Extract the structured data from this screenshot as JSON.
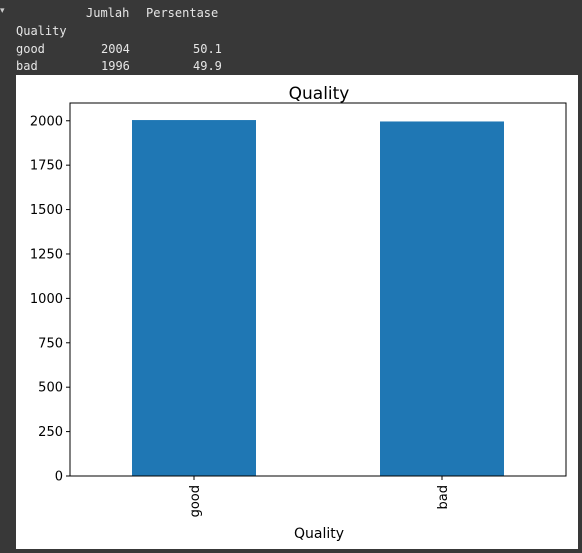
{
  "dataframe": {
    "columns": [
      "Jumlah",
      "Persentase"
    ],
    "index_name": "Quality",
    "rows": [
      {
        "label": "good",
        "jumlah": "2004",
        "persentase": "50.1"
      },
      {
        "label": "bad",
        "jumlah": "1996",
        "persentase": "49.9"
      }
    ]
  },
  "colors": {
    "bar": "#1f77b4",
    "background": "#383838"
  },
  "chart_data": {
    "type": "bar",
    "title": "Quality",
    "xlabel": "Quality",
    "ylabel": "",
    "categories": [
      "good",
      "bad"
    ],
    "values": [
      2004,
      1996
    ],
    "ylim": [
      0,
      2100
    ],
    "yticks": [
      0,
      250,
      500,
      750,
      1000,
      1250,
      1500,
      1750,
      2000
    ],
    "grid": false,
    "legend": "none"
  }
}
